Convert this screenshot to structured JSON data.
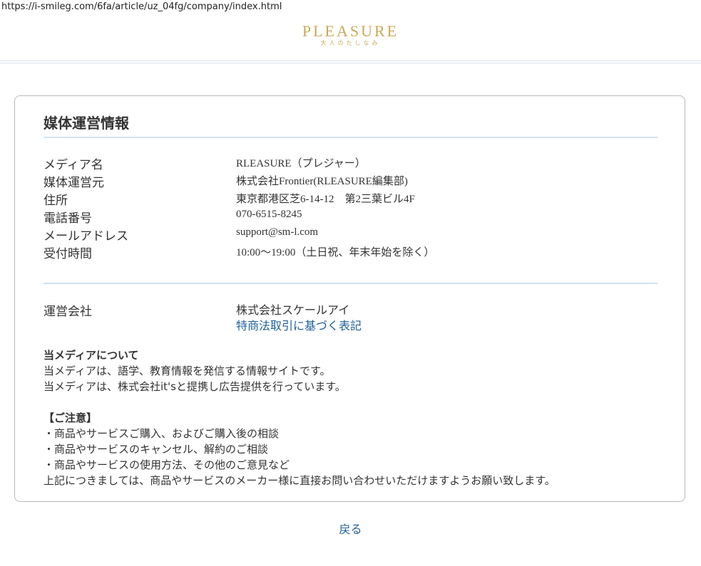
{
  "browser": {
    "url": "https://i-smileg.com/6fa/article/uz_04fg/company/index.html"
  },
  "header": {
    "logo_text": "PLEASURE",
    "logo_subtext": "大人のたしなみ",
    "logo_color": "#c8aa55"
  },
  "card": {
    "title": "媒体運営情報",
    "info_rows": [
      {
        "label": "メディア名",
        "value": "RLEASURE（プレジャー）"
      },
      {
        "label": "媒体運営元",
        "value": "株式会社Frontier(RLEASURE編集部)"
      },
      {
        "label": "住所",
        "value": "東京都港区芝6-14-12　第2三葉ビル4F"
      },
      {
        "label": "電話番号",
        "value": "070-6515-8245"
      },
      {
        "label": "メールアドレス",
        "value": "support@sm-l.com"
      },
      {
        "label": "受付時間",
        "value": "10:00〜19:00（土日祝、年末年始を除く）"
      }
    ],
    "operator": {
      "label": "運営会社",
      "value": "株式会社スケールアイ",
      "link": "特商法取引に基づく表記"
    },
    "about": {
      "heading": "当メディアについて",
      "line1": "当メディアは、語学、教育情報を発信する情報サイトです。",
      "line2": "当メディアは、株式会社it'sと提携し広告提供を行っています。"
    },
    "notice": {
      "heading": "【ご注意】",
      "items": [
        "・商品やサービスご購入、およびご購入後の相談",
        "・商品やサービスのキャンセル、解約のご相談",
        "・商品やサービスの使用方法、その他のご意見など"
      ],
      "footer": "上記につきましては、商品やサービスのメーカー様に直接お問い合わせいただけますようお願い致します。"
    }
  },
  "back_link": "戻る",
  "colors": {
    "link": "#1f5f9a",
    "rule": "#cfe2f3"
  }
}
